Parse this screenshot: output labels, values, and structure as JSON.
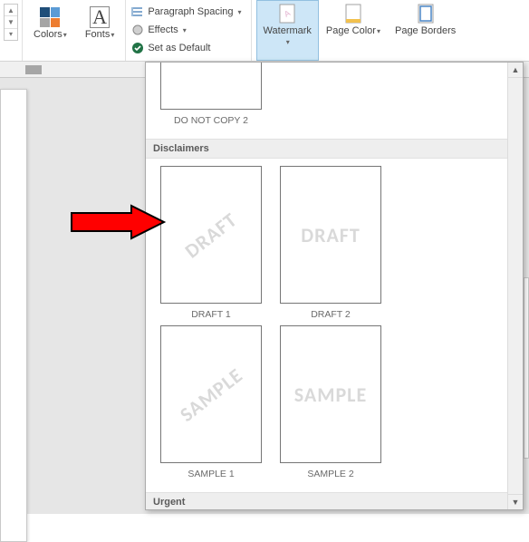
{
  "ribbon": {
    "colors_label": "Colors",
    "fonts_label": "Fonts",
    "fonts_glyph": "A",
    "paragraph_spacing": "Paragraph Spacing",
    "effects": "Effects",
    "set_default": "Set as Default",
    "watermark": "Watermark",
    "page_color": "Page Color",
    "page_borders": "Page Borders"
  },
  "gallery": {
    "top_partial_thumb_label": "DO NOT COPY 2",
    "sections": {
      "disclaimers": {
        "title": "Disclaimers",
        "items": [
          {
            "text": "DRAFT",
            "diagonal": true,
            "label": "DRAFT 1"
          },
          {
            "text": "DRAFT",
            "diagonal": false,
            "label": "DRAFT 2"
          },
          {
            "text": "SAMPLE",
            "diagonal": true,
            "label": "SAMPLE 1"
          },
          {
            "text": "SAMPLE",
            "diagonal": false,
            "label": "SAMPLE 2"
          }
        ]
      },
      "urgent": {
        "title": "Urgent"
      }
    }
  }
}
